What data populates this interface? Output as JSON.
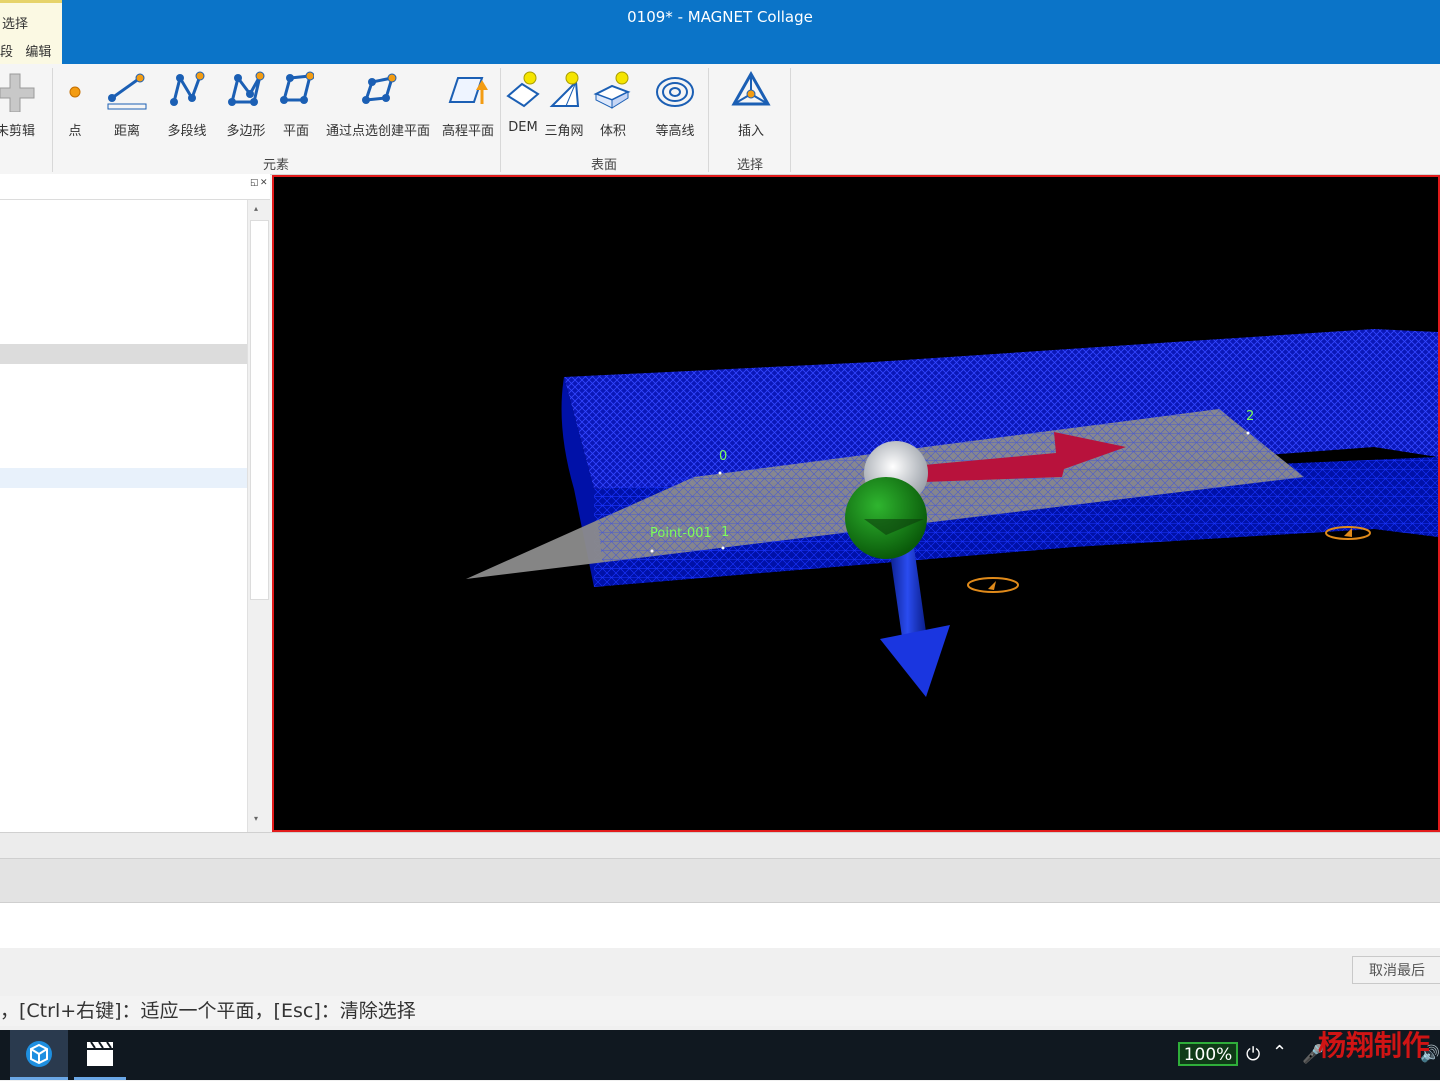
{
  "window": {
    "title": "0109* - MAGNET Collage"
  },
  "tabs": {
    "select": "选择",
    "left_partial": "段",
    "edit": "编辑"
  },
  "ribbon": {
    "partial_label": "未剪辑",
    "buttons": [
      {
        "label": "点",
        "icon": "point-icon"
      },
      {
        "label": "距离",
        "icon": "distance-icon"
      },
      {
        "label": "多段线",
        "icon": "polyline-icon"
      },
      {
        "label": "多边形",
        "icon": "polygon-icon"
      },
      {
        "label": "平面",
        "icon": "plane-icon"
      },
      {
        "label": "通过点选创建平面",
        "icon": "plane-from-points-icon"
      },
      {
        "label": "高程平面",
        "icon": "elevation-plane-icon"
      },
      {
        "label": "DEM",
        "icon": "dem-icon"
      },
      {
        "label": "三角网",
        "icon": "tin-icon"
      },
      {
        "label": "体积",
        "icon": "volume-icon"
      },
      {
        "label": "等高线",
        "icon": "contour-icon"
      },
      {
        "label": "插入",
        "icon": "insert-icon"
      }
    ],
    "groups": {
      "elements": "元素",
      "surface": "表面",
      "select": "选择"
    }
  },
  "viewport": {
    "labels": {
      "point_name": "Point-001",
      "p0": "0",
      "p1": "1",
      "p2": "2"
    }
  },
  "bottom": {
    "undo_label": "取消最后",
    "status": "，[Ctrl+右键]：适应一个平面，[Esc]：清除选择"
  },
  "taskbar": {
    "battery": "100%"
  },
  "watermark": "杨翔制作",
  "colors": {
    "titlebar": "#0b74c8",
    "viewport_border": "#e21b1b",
    "mesh": "#1a2cff",
    "plane": "#8c8c8c"
  }
}
